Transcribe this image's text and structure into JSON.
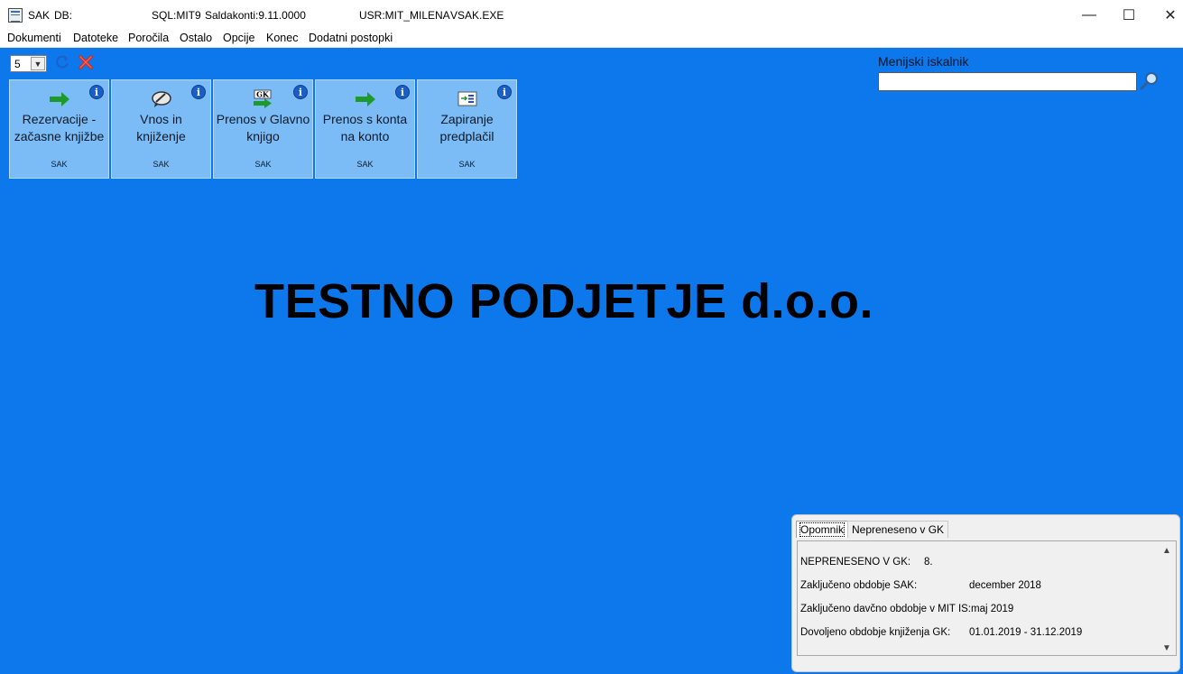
{
  "window": {
    "title_app": "SAK",
    "title_db": "DB:",
    "title_sql": "SQL:MIT9",
    "title_saldakonti": "Saldakonti:9.11.0000",
    "title_user": "USR:MIT_MILENA",
    "title_exe": "VSAK.EXE",
    "minimize": "—",
    "maximize": "☐",
    "close": "✕"
  },
  "menu": [
    {
      "label": "Dokumenti"
    },
    {
      "label": "Datoteke"
    },
    {
      "label": "Poročila"
    },
    {
      "label": "Ostalo"
    },
    {
      "label": "Opcije"
    },
    {
      "label": "Konec"
    },
    {
      "label": "Dodatni postopki"
    }
  ],
  "toolbar": {
    "selected_value": "5",
    "refresh_icon": "refresh-icon",
    "cancel_icon": "cancel-icon"
  },
  "tiles": [
    {
      "line1": "Rezervacije -",
      "line2": "začasne knjižbe",
      "tag": "SAK",
      "icon": "green-arrow-icon"
    },
    {
      "line1": "Vnos in",
      "line2": "knjiženje",
      "tag": "SAK",
      "icon": "pen-icon"
    },
    {
      "line1": "Prenos v Glavno",
      "line2": "knjigo",
      "tag": "SAK",
      "icon": "gk-arrow-icon"
    },
    {
      "line1": "Prenos s konta",
      "line2": "na konto",
      "tag": "SAK",
      "icon": "green-arrow-icon"
    },
    {
      "line1": "Zapiranje",
      "line2": "predplačil",
      "tag": "SAK",
      "icon": "match-icon"
    }
  ],
  "company_name": "TESTNO PODJETJE d.o.o.",
  "search": {
    "label": "Menijski iskalnik",
    "value": ""
  },
  "panel": {
    "tabs": [
      {
        "label": "Opomnik",
        "active": true
      },
      {
        "label": "Nepreneseno v GK",
        "active": false
      }
    ],
    "rows": [
      {
        "key": "NEPRENESENO V GK:",
        "value": "8."
      },
      {
        "key": "Zaključeno obdobje SAK:",
        "value": "december  2018"
      },
      {
        "key": "Zaključeno davčno obdobje v MIT IS:",
        "value": "maj  2019"
      },
      {
        "key": "Dovoljeno obdobje knjiženja GK:",
        "value": "01.01.2019 - 31.12.2019"
      }
    ]
  },
  "colors": {
    "background": "#0c78ec",
    "tile": "#7cbcf6",
    "info": "#1a5fc4"
  }
}
